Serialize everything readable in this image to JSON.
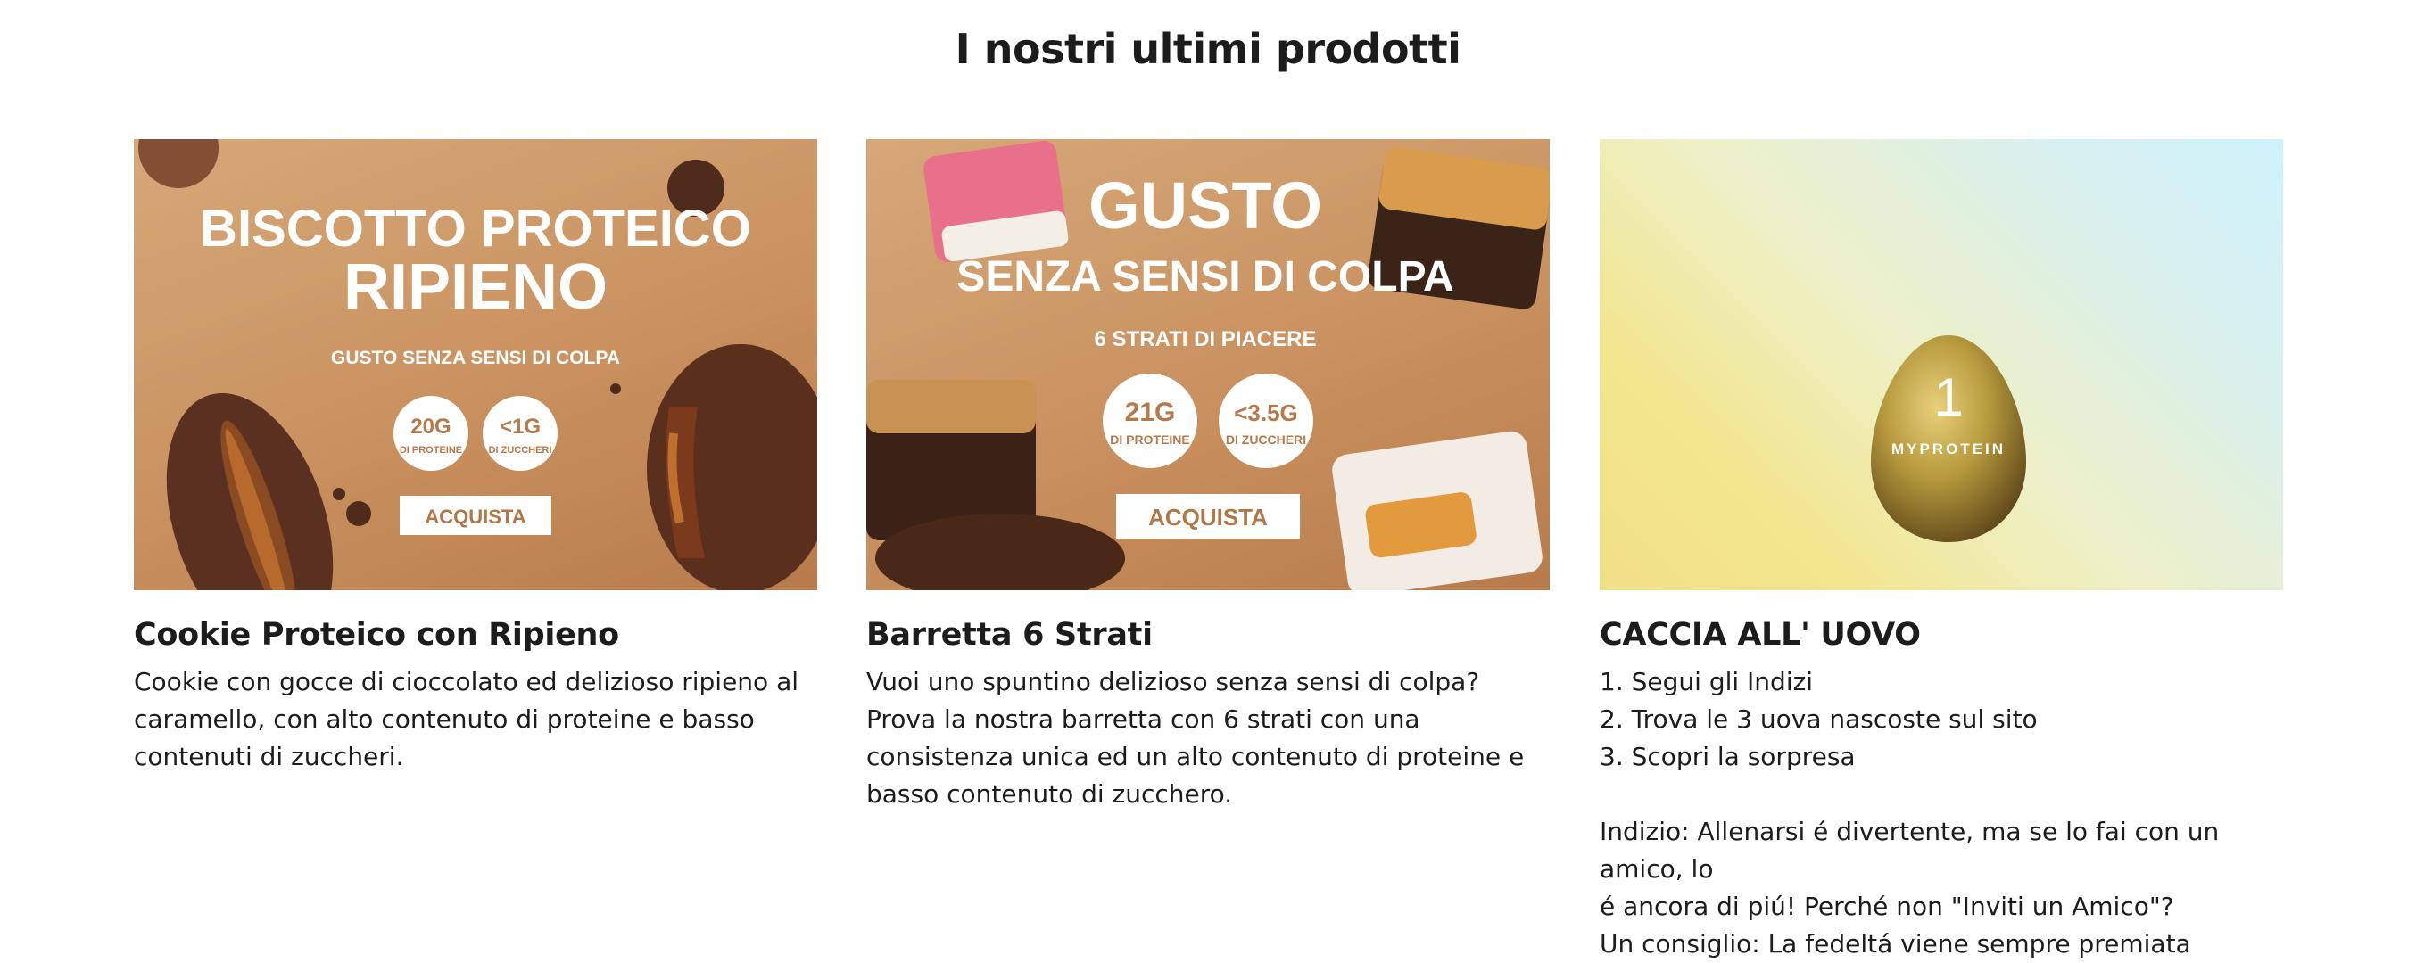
{
  "section": {
    "title": "I nostri ultimi prodotti"
  },
  "cards": [
    {
      "title": "Cookie Proteico con Ripieno",
      "description": "Cookie con gocce di cioccolato ed delizioso ripieno al caramello, con alto contenuto di proteine e basso contenuti di zuccheri.",
      "banner": {
        "line1": "BISCOTTO PROTEICO",
        "line2": "RIPIENO",
        "tagline": "GUSTO SENZA SENSI DI COLPA",
        "badge1_value": "20G",
        "badge1_label": "DI PROTEINE",
        "badge2_value": "<1G",
        "badge2_label": "DI ZUCCHERI",
        "button": "ACQUISTA"
      }
    },
    {
      "title": "Barretta 6 Strati",
      "description": "Vuoi uno spuntino delizioso senza sensi di colpa? Prova la nostra barretta con 6 strati con una consistenza unica ed un alto contenuto di proteine e basso contenuto di zucchero.",
      "banner": {
        "line1": "GUSTO",
        "line2": "SENZA SENSI DI COLPA",
        "tagline": "6 STRATI DI PIACERE",
        "badge1_value": "21G",
        "badge1_label": "DI PROTEINE",
        "badge2_value": "<3.5G",
        "badge2_label": "DI ZUCCHERI",
        "button": "ACQUISTA"
      }
    },
    {
      "title": "CACCIA ALL' UOVO",
      "lines": [
        "1. Segui gli Indizi",
        "2. Trova le 3 uova nascoste sul sito",
        "3. Scopri la sorpresa",
        "",
        "Indizio: Allenarsi é divertente, ma se lo fai con un amico, lo",
        "é ancora di piú! Perché non \"Inviti un Amico\"?",
        "Un consiglio: La fedeltá viene sempre premiata"
      ],
      "banner": {
        "egg_number": "1",
        "egg_brand": "MYPROTEIN"
      }
    }
  ]
}
